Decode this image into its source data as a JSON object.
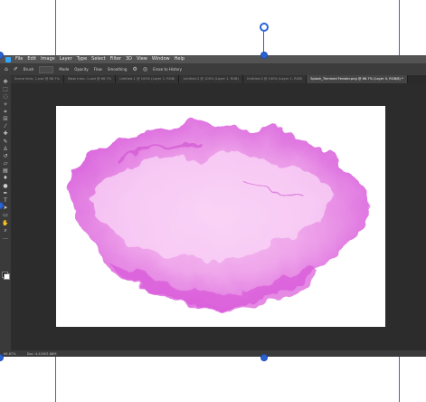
{
  "app": {
    "name": "Photoshop"
  },
  "menu": [
    "File",
    "Edit",
    "Image",
    "Layer",
    "Type",
    "Select",
    "Filter",
    "3D",
    "View",
    "Window",
    "Help"
  ],
  "options_bar": {
    "label": "Erase to History",
    "items": [
      "Brush",
      "Mode",
      "Opacity",
      "Flow",
      "Smoothing"
    ]
  },
  "tabs": [
    {
      "label": "Scene Intro, 1.psd @ 66.7%",
      "active": false
    },
    {
      "label": "Mask Intro, 1.psd @ 66.7%",
      "active": false
    },
    {
      "label": "Untitled-1 @ 100% (Layer 1, RGB)",
      "active": false
    },
    {
      "label": "Untitled-2 @ 100% (Layer 1, RGB)",
      "active": false
    },
    {
      "label": "Untitled-3 @ 100% (Layer 1, RGB)",
      "active": false
    },
    {
      "label": "Splash_Trimmed Fenster.png @ 66.7% (Layer 0, RGB/8) *",
      "active": true
    }
  ],
  "tools": [
    "move-icon",
    "marquee-icon",
    "lasso-icon",
    "magic-wand-icon",
    "crop-icon",
    "frame-icon",
    "eyedropper-icon",
    "healing-brush-icon",
    "brush-icon",
    "clone-stamp-icon",
    "history-brush-icon",
    "eraser-icon",
    "gradient-icon",
    "blur-icon",
    "dodge-icon",
    "pen-icon",
    "type-icon",
    "path-selection-icon",
    "rectangle-icon",
    "hand-icon",
    "zoom-icon",
    "more-tools-icon"
  ],
  "status": {
    "zoom": "66.67%",
    "doc": "Doc: 4.41M/5.88M"
  },
  "colors": {
    "guide": "#3d63d6",
    "handle": "#2a63d4",
    "app_bg": "#2c2c2c",
    "splash": "#e07ae6"
  }
}
